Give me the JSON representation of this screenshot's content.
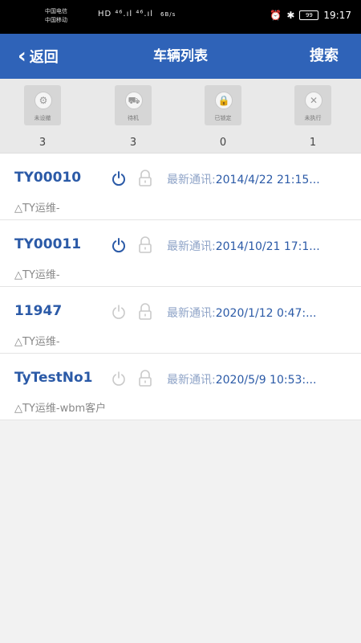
{
  "status_bar": {
    "carrier_1": "中国电信",
    "carrier_2": "中国移动",
    "signal": "HD ⁴⁶.ıl ⁴⁶.ıl",
    "network": "6B/s",
    "battery": "99",
    "time": "19:17"
  },
  "navbar": {
    "back_label": "返回",
    "title": "车辆列表",
    "search_label": "搜索"
  },
  "summary": [
    {
      "label": "未设撤",
      "count": "3",
      "icon": "gear-icon"
    },
    {
      "label": "待机",
      "count": "3",
      "icon": "car-icon"
    },
    {
      "label": "已锁定",
      "count": "0",
      "icon": "lock-icon"
    },
    {
      "label": "未执行",
      "count": "1",
      "icon": "cancel-icon"
    }
  ],
  "vehicles": [
    {
      "id": "TY00010",
      "comm_label": "最新通讯:",
      "comm_time": "2014/4/22 21:15...",
      "group": "△TY运维-",
      "power_on": true
    },
    {
      "id": "TY00011",
      "comm_label": "最新通讯:",
      "comm_time": "2014/10/21 17:1...",
      "group": "△TY运维-",
      "power_on": true
    },
    {
      "id": "11947",
      "comm_label": "最新通讯:",
      "comm_time": "2020/1/12 0:47:...",
      "group": "△TY运维-",
      "power_on": false
    },
    {
      "id": "TyTestNo1",
      "comm_label": "最新通讯:",
      "comm_time": "2020/5/9 10:53:...",
      "group": "△TY运维-wbm客户",
      "power_on": false
    }
  ],
  "colors": {
    "primary": "#2f63b8",
    "text_blue": "#2b5aa7",
    "inactive": "#c9c9c9"
  }
}
